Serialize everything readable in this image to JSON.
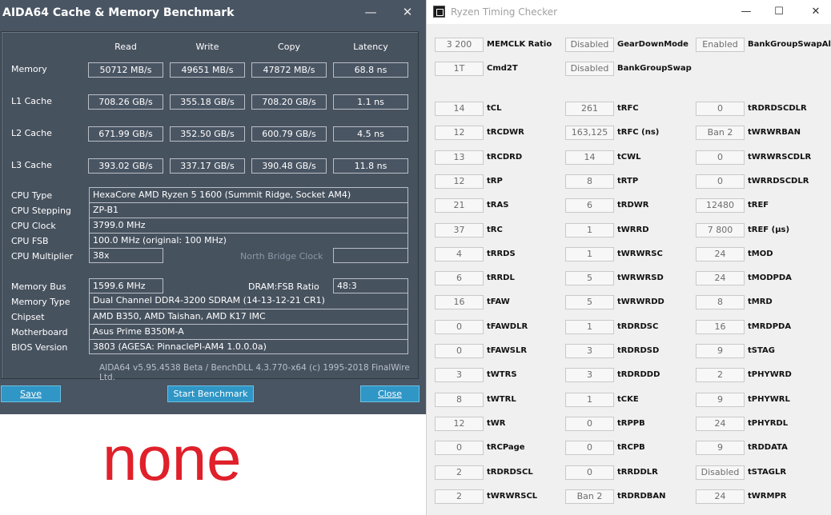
{
  "aida": {
    "title": "AIDA64 Cache & Memory Benchmark",
    "minimize": "—",
    "close": "✕",
    "columns": [
      "Read",
      "Write",
      "Copy",
      "Latency"
    ],
    "rows": [
      {
        "label": "Memory",
        "read": "50712 MB/s",
        "write": "49651 MB/s",
        "copy": "47872 MB/s",
        "latency": "68.8 ns"
      },
      {
        "label": "L1 Cache",
        "read": "708.26 GB/s",
        "write": "355.18 GB/s",
        "copy": "708.20 GB/s",
        "latency": "1.1 ns"
      },
      {
        "label": "L2 Cache",
        "read": "671.99 GB/s",
        "write": "352.50 GB/s",
        "copy": "600.79 GB/s",
        "latency": "4.5 ns"
      },
      {
        "label": "L3 Cache",
        "read": "393.02 GB/s",
        "write": "337.17 GB/s",
        "copy": "390.48 GB/s",
        "latency": "11.8 ns"
      }
    ],
    "cpu": {
      "type_label": "CPU Type",
      "type": "HexaCore AMD Ryzen 5 1600  (Summit Ridge, Socket AM4)",
      "stepping_label": "CPU Stepping",
      "stepping": "ZP-B1",
      "clock_label": "CPU Clock",
      "clock": "3799.0 MHz",
      "fsb_label": "CPU FSB",
      "fsb": "100.0 MHz  (original: 100 MHz)",
      "multiplier_label": "CPU Multiplier",
      "multiplier": "38x",
      "nb_clock_label": "North Bridge Clock",
      "nb_clock": ""
    },
    "mem": {
      "bus_label": "Memory Bus",
      "bus": "1599.6 MHz",
      "ratio_label": "DRAM:FSB Ratio",
      "ratio": "48:3",
      "type_label": "Memory Type",
      "type": "Dual Channel DDR4-3200 SDRAM  (14-13-12-21 CR1)",
      "chipset_label": "Chipset",
      "chipset": "AMD B350, AMD Taishan, AMD K17 IMC",
      "motherboard_label": "Motherboard",
      "motherboard": "Asus Prime B350M-A",
      "bios_label": "BIOS Version",
      "bios": "3803  (AGESA: PinnaclePI-AM4 1.0.0.0a)"
    },
    "footer": "AIDA64 v5.95.4538 Beta / BenchDLL 4.3.770-x64  (c) 1995-2018 FinalWire Ltd.",
    "buttons": {
      "save": "Save",
      "start": "Start Benchmark",
      "close": "Close"
    }
  },
  "none_text": "none",
  "rtc": {
    "title": "Ryzen Timing Checker",
    "controls": {
      "minimize": "—",
      "maximize": "☐",
      "close": "✕"
    },
    "top": [
      [
        {
          "value": "3 200",
          "label": "MEMCLK Ratio"
        },
        {
          "value": "Disabled",
          "label": "GearDownMode"
        },
        {
          "value": "Enabled",
          "label": "BankGroupSwapAlt"
        }
      ],
      [
        {
          "value": "1T",
          "label": "Cmd2T"
        },
        {
          "value": "Disabled",
          "label": "BankGroupSwap"
        },
        null
      ]
    ],
    "timings": [
      [
        {
          "value": "14",
          "label": "tCL"
        },
        {
          "value": "261",
          "label": "tRFC"
        },
        {
          "value": "0",
          "label": "tRDRDSCDLR"
        }
      ],
      [
        {
          "value": "12",
          "label": "tRCDWR"
        },
        {
          "value": "163,125",
          "label": "tRFC (ns)"
        },
        {
          "value": "Ban 2",
          "label": "tWRWRBAN"
        }
      ],
      [
        {
          "value": "13",
          "label": "tRCDRD"
        },
        {
          "value": "14",
          "label": "tCWL"
        },
        {
          "value": "0",
          "label": "tWRWRSCDLR"
        }
      ],
      [
        {
          "value": "12",
          "label": "tRP"
        },
        {
          "value": "8",
          "label": "tRTP"
        },
        {
          "value": "0",
          "label": "tWRRDSCDLR"
        }
      ],
      [
        {
          "value": "21",
          "label": "tRAS"
        },
        {
          "value": "6",
          "label": "tRDWR"
        },
        {
          "value": "12480",
          "label": "tREF"
        }
      ],
      [
        {
          "value": "37",
          "label": "tRC"
        },
        {
          "value": "1",
          "label": "tWRRD"
        },
        {
          "value": "7 800",
          "label": "tREF (µs)"
        }
      ],
      [
        {
          "value": "4",
          "label": "tRRDS"
        },
        {
          "value": "1",
          "label": "tWRWRSC"
        },
        {
          "value": "24",
          "label": "tMOD"
        }
      ],
      [
        {
          "value": "6",
          "label": "tRRDL"
        },
        {
          "value": "5",
          "label": "tWRWRSD"
        },
        {
          "value": "24",
          "label": "tMODPDA"
        }
      ],
      [
        {
          "value": "16",
          "label": "tFAW"
        },
        {
          "value": "5",
          "label": "tWRWRDD"
        },
        {
          "value": "8",
          "label": "tMRD"
        }
      ],
      [
        {
          "value": "0",
          "label": "tFAWDLR"
        },
        {
          "value": "1",
          "label": "tRDRDSC"
        },
        {
          "value": "16",
          "label": "tMRDPDA"
        }
      ],
      [
        {
          "value": "0",
          "label": "tFAWSLR"
        },
        {
          "value": "3",
          "label": "tRDRDSD"
        },
        {
          "value": "9",
          "label": "tSTAG"
        }
      ],
      [
        {
          "value": "3",
          "label": "tWTRS"
        },
        {
          "value": "3",
          "label": "tRDRDDD"
        },
        {
          "value": "2",
          "label": "tPHYWRD"
        }
      ],
      [
        {
          "value": "8",
          "label": "tWTRL"
        },
        {
          "value": "1",
          "label": "tCKE"
        },
        {
          "value": "9",
          "label": "tPHYWRL"
        }
      ],
      [
        {
          "value": "12",
          "label": "tWR"
        },
        {
          "value": "0",
          "label": "tRPPB"
        },
        {
          "value": "24",
          "label": "tPHYRDL"
        }
      ],
      [
        {
          "value": "0",
          "label": "tRCPage"
        },
        {
          "value": "0",
          "label": "tRCPB"
        },
        {
          "value": "9",
          "label": "tRDDATA"
        }
      ],
      [
        {
          "value": "2",
          "label": "tRDRDSCL"
        },
        {
          "value": "0",
          "label": "tRRDDLR"
        },
        {
          "value": "Disabled",
          "label": "tSTAGLR"
        }
      ],
      [
        {
          "value": "2",
          "label": "tWRWRSCL"
        },
        {
          "value": "Ban 2",
          "label": "tRDRDBAN"
        },
        {
          "value": "24",
          "label": "tWRMPR"
        }
      ]
    ]
  }
}
